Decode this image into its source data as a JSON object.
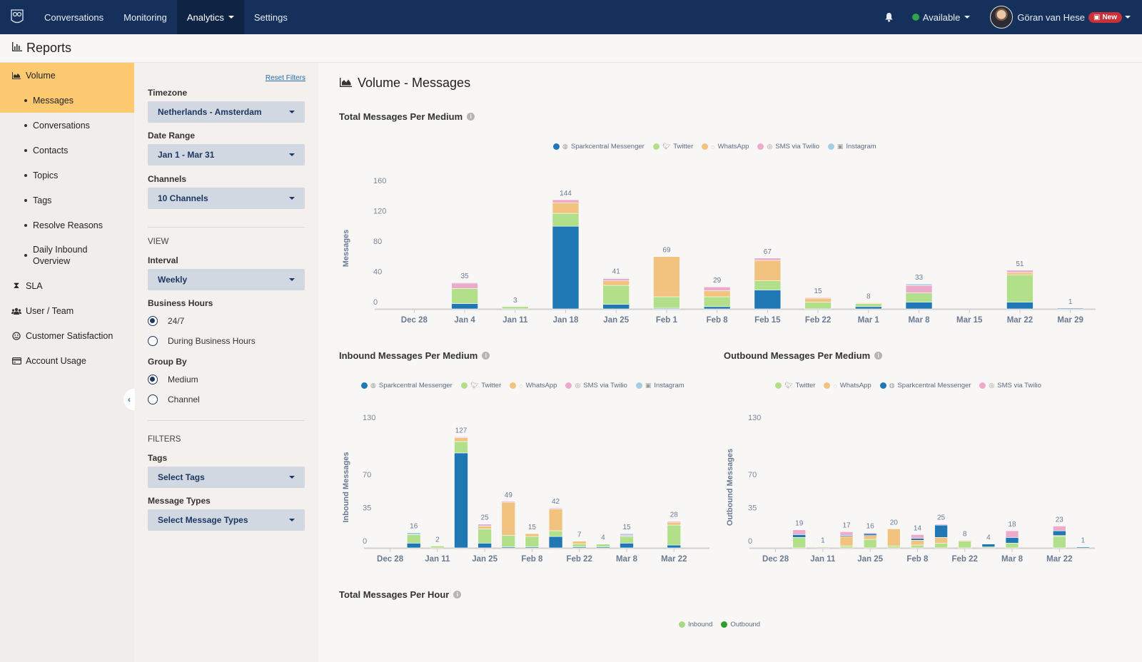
{
  "topnav": {
    "items": [
      "Conversations",
      "Monitoring",
      "Analytics",
      "Settings"
    ],
    "active": "Analytics",
    "status": "Available",
    "status_color": "#2ea44f",
    "user_name": "Göran van Hese",
    "new_badge": "New"
  },
  "page": {
    "title": "Reports"
  },
  "sidebar": {
    "volume": "Volume",
    "volume_items": [
      "Messages",
      "Conversations",
      "Contacts",
      "Topics",
      "Tags",
      "Resolve Reasons",
      "Daily Inbound Overview"
    ],
    "active_item": "Messages",
    "sections": [
      {
        "label": "SLA",
        "icon": "hourglass-icon"
      },
      {
        "label": "User / Team",
        "icon": "users-icon"
      },
      {
        "label": "Customer Satisfaction",
        "icon": "smiley-icon"
      },
      {
        "label": "Account Usage",
        "icon": "credit-card-icon"
      }
    ]
  },
  "filters": {
    "reset": "Reset Filters",
    "timezone_label": "Timezone",
    "timezone": "Netherlands - Amsterdam",
    "date_range_label": "Date Range",
    "date_range": "Jan 1 - Mar 31",
    "channels_label": "Channels",
    "channels": "10 Channels",
    "view_heading": "VIEW",
    "interval_label": "Interval",
    "interval": "Weekly",
    "business_hours_label": "Business Hours",
    "business_hours_options": [
      "24/7",
      "During Business Hours"
    ],
    "business_hours_selected": "24/7",
    "group_by_label": "Group By",
    "group_by_options": [
      "Medium",
      "Channel"
    ],
    "group_by_selected": "Medium",
    "filters_heading": "FILTERS",
    "tags_label": "Tags",
    "tags": "Select Tags",
    "message_types_label": "Message Types",
    "message_types": "Select Message Types"
  },
  "main": {
    "title": "Volume - Messages",
    "per_hour_title": "Total Messages Per Hour",
    "per_hour_legend": [
      {
        "name": "Inbound",
        "color": "#a8d98a"
      },
      {
        "name": "Outbound",
        "color": "#2ca02c"
      }
    ]
  },
  "colors": {
    "Sparkcentral Messenger": "#1f77b4",
    "Twitter": "#b2df8a",
    "WhatsApp": "#f2c27f",
    "SMS via Twilio": "#eeaacb",
    "Instagram": "#a6cee3"
  },
  "chart_data": [
    {
      "id": "total",
      "type": "bar",
      "stacked": true,
      "title": "Total Messages Per Medium",
      "xlabel": "",
      "ylabel": "Messages",
      "yticks": [
        0,
        40,
        80,
        120,
        160
      ],
      "ylim": [
        0,
        160
      ],
      "legend_position": "top-center",
      "legend": [
        "Sparkcentral Messenger",
        "Twitter",
        "WhatsApp",
        "SMS via Twilio",
        "Instagram"
      ],
      "categories": [
        "Dec 28",
        "Jan 4",
        "Jan 11",
        "Jan 18",
        "Jan 25",
        "Feb 1",
        "Feb 8",
        "Feb 15",
        "Feb 22",
        "Mar 1",
        "Mar 8",
        "Mar 15",
        "Mar 22",
        "Mar 29"
      ],
      "totals": [
        0,
        35,
        3,
        144,
        41,
        69,
        29,
        67,
        15,
        8,
        33,
        0,
        51,
        1
      ],
      "series": [
        {
          "name": "Sparkcentral Messenger",
          "values": [
            0,
            7,
            0,
            109,
            6,
            1,
            3,
            25,
            0,
            3,
            9,
            0,
            9,
            1
          ]
        },
        {
          "name": "Twitter",
          "values": [
            0,
            20,
            3,
            17,
            25,
            15,
            13,
            12,
            9,
            4,
            12,
            0,
            36,
            0
          ]
        },
        {
          "name": "WhatsApp",
          "values": [
            0,
            0,
            0,
            14,
            6,
            53,
            8,
            27,
            5,
            1,
            0,
            0,
            3,
            0
          ]
        },
        {
          "name": "SMS via Twilio",
          "values": [
            0,
            7,
            0,
            4,
            3,
            0,
            5,
            3,
            1,
            0,
            10,
            0,
            3,
            0
          ]
        },
        {
          "name": "Instagram",
          "values": [
            0,
            1,
            0,
            0,
            1,
            0,
            0,
            0,
            0,
            0,
            2,
            0,
            0,
            0
          ]
        }
      ],
      "data_labels": true,
      "grid": false
    },
    {
      "id": "inbound",
      "type": "bar",
      "stacked": true,
      "title": "Inbound Messages Per Medium",
      "xlabel": "",
      "ylabel": "Inbound Messages",
      "yticks": [
        0,
        35,
        70,
        130
      ],
      "ylim": [
        0,
        130
      ],
      "legend_position": "top-center",
      "legend": [
        "Sparkcentral Messenger",
        "Twitter",
        "WhatsApp",
        "SMS via Twilio",
        "Instagram"
      ],
      "categories": [
        "Dec 28",
        "Jan 4",
        "Jan 11",
        "Jan 18",
        "Jan 25",
        "Feb 1",
        "Feb 8",
        "Feb 15",
        "Feb 22",
        "Mar 1",
        "Mar 8",
        "Mar 15",
        "Mar 22",
        "Mar 29"
      ],
      "xtick_labels": [
        "Dec 28",
        "Jan 11",
        "Jan 25",
        "Feb 8",
        "Feb 22",
        "Mar 8",
        "Mar 22"
      ],
      "totals": [
        0,
        16,
        2,
        127,
        25,
        49,
        15,
        42,
        7,
        4,
        15,
        0,
        28,
        0
      ],
      "series": [
        {
          "name": "Sparkcentral Messenger",
          "values": [
            0,
            5,
            0,
            100,
            5,
            1,
            1,
            12,
            1,
            1,
            5,
            0,
            3,
            0
          ]
        },
        {
          "name": "Twitter",
          "values": [
            0,
            9,
            2,
            12,
            15,
            12,
            11,
            6,
            3,
            3,
            7,
            0,
            21,
            0
          ]
        },
        {
          "name": "WhatsApp",
          "values": [
            0,
            0,
            0,
            4,
            3,
            35,
            3,
            23,
            3,
            0,
            0,
            0,
            3,
            0
          ]
        },
        {
          "name": "SMS via Twilio",
          "values": [
            0,
            0,
            0,
            1,
            2,
            1,
            0,
            1,
            0,
            0,
            1,
            0,
            1,
            0
          ]
        },
        {
          "name": "Instagram",
          "values": [
            0,
            2,
            0,
            0,
            0,
            0,
            0,
            0,
            0,
            0,
            2,
            0,
            0,
            0
          ]
        }
      ],
      "data_labels": true,
      "grid": false
    },
    {
      "id": "outbound",
      "type": "bar",
      "stacked": true,
      "title": "Outbound Messages Per Medium",
      "xlabel": "",
      "ylabel": "Outbound Messages",
      "yticks": [
        0,
        35,
        70,
        130
      ],
      "ylim": [
        0,
        130
      ],
      "legend_position": "top-center",
      "legend": [
        "Twitter",
        "WhatsApp",
        "Sparkcentral Messenger",
        "SMS via Twilio"
      ],
      "categories": [
        "Dec 28",
        "Jan 4",
        "Jan 11",
        "Jan 18",
        "Jan 25",
        "Feb 1",
        "Feb 8",
        "Feb 15",
        "Feb 22",
        "Mar 1",
        "Mar 8",
        "Mar 15",
        "Mar 22",
        "Mar 29"
      ],
      "xtick_labels": [
        "Dec 28",
        "Jan 11",
        "Jan 25",
        "Feb 8",
        "Feb 22",
        "Mar 8",
        "Mar 22"
      ],
      "totals": [
        0,
        19,
        1,
        17,
        16,
        20,
        14,
        25,
        8,
        4,
        18,
        0,
        23,
        1
      ],
      "series": [
        {
          "name": "Twitter",
          "values": [
            0,
            11,
            1,
            2,
            9,
            2,
            3,
            5,
            7,
            1,
            5,
            0,
            12,
            0
          ]
        },
        {
          "name": "WhatsApp",
          "values": [
            0,
            0,
            0,
            10,
            4,
            18,
            5,
            6,
            1,
            0,
            0,
            0,
            1,
            0
          ]
        },
        {
          "name": "Sparkcentral Messenger",
          "values": [
            0,
            3,
            0,
            1,
            2,
            0,
            2,
            13,
            0,
            3,
            6,
            0,
            5,
            1
          ]
        },
        {
          "name": "SMS via Twilio",
          "values": [
            0,
            5,
            0,
            4,
            1,
            0,
            4,
            1,
            0,
            0,
            7,
            0,
            5,
            0
          ]
        }
      ],
      "data_labels": true,
      "grid": false
    }
  ]
}
